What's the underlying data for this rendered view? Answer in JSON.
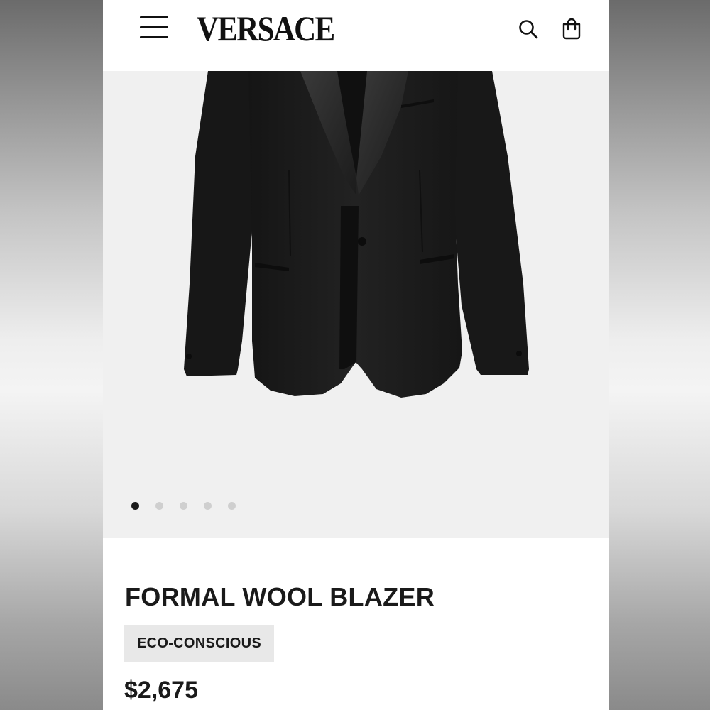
{
  "header": {
    "brand": "VERSACE"
  },
  "product": {
    "title": "FORMAL WOOL BLAZER",
    "badge": "ECO-CONSCIOUS",
    "price": "$2,675"
  },
  "gallery": {
    "image_count": 5,
    "active_index": 0
  },
  "colors": {
    "accent": "#111111",
    "hero_background": "#f0f0f0",
    "badge_background": "#e8e8e8",
    "dot_active": "#1a1a1a",
    "dot_inactive": "#cfcfcf"
  },
  "icons": [
    "hamburger-menu-icon",
    "search-icon",
    "shopping-bag-icon"
  ]
}
